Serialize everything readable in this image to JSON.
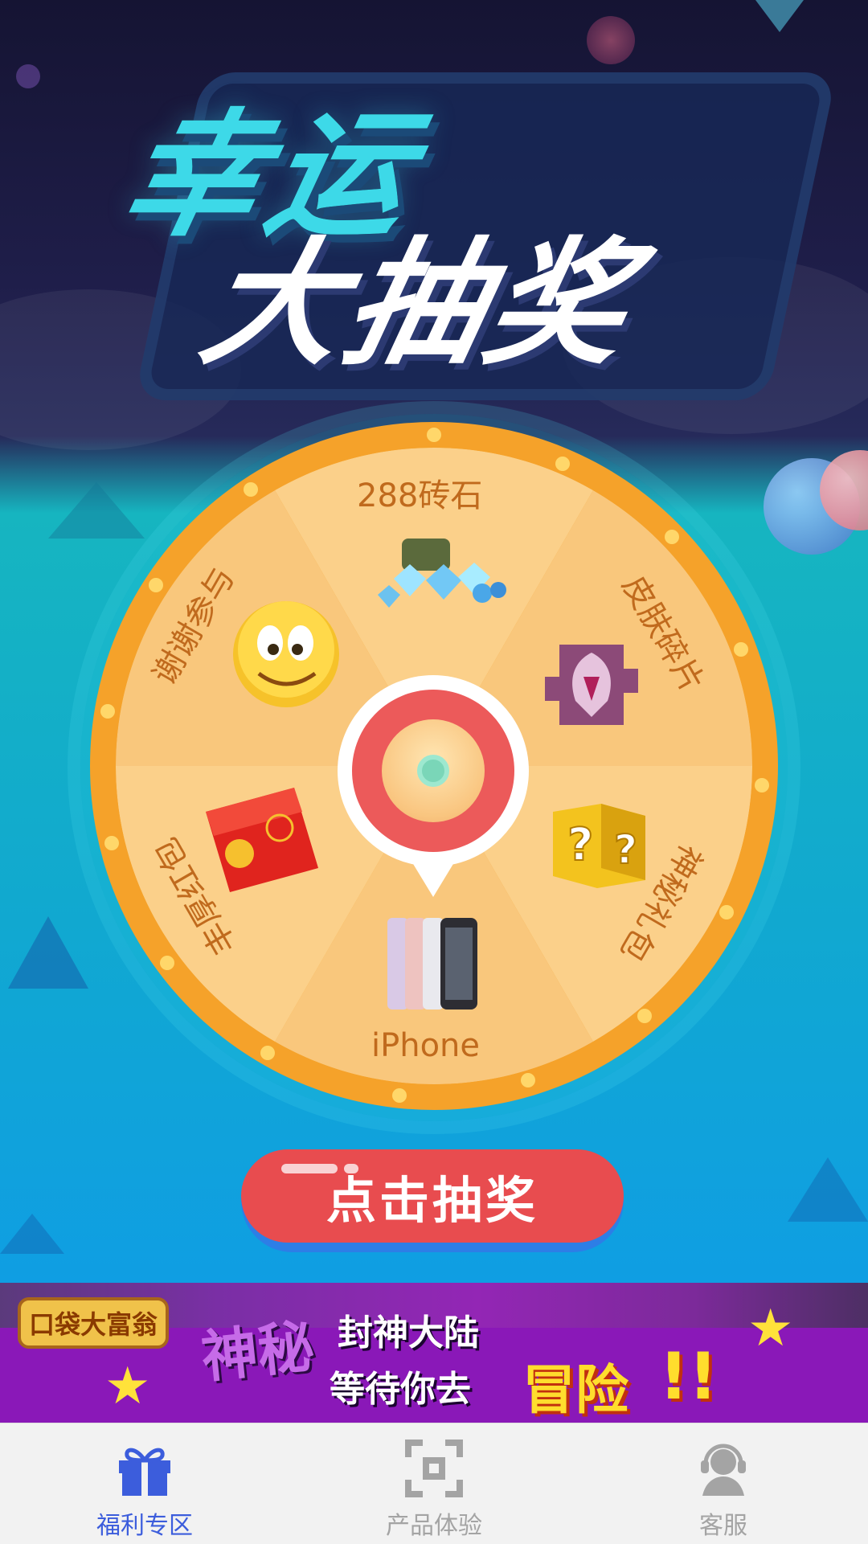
{
  "title": {
    "line1": "幸运",
    "line2": "大抽奖"
  },
  "wheel": {
    "prizes": [
      {
        "label": "288砖石",
        "icon": "diamonds-icon"
      },
      {
        "label": "皮肤碎片",
        "icon": "skin-fragment-icon"
      },
      {
        "label": "神秘礼包",
        "icon": "mystery-box-icon"
      },
      {
        "label": "iPhone",
        "icon": "iphone-icon"
      },
      {
        "label": "丰厚红包",
        "icon": "red-envelope-icon"
      },
      {
        "label": "谢谢参与",
        "icon": "smiley-icon"
      }
    ],
    "colors": {
      "ring": "#f5a22a",
      "segment": "#fbd08a",
      "center": "#ec5a5a"
    }
  },
  "draw_button": {
    "label": "点击抽奖"
  },
  "banner": {
    "logo": "口袋大富翁",
    "text1": "神秘",
    "text2": "封神大陆",
    "text3": "等待你去",
    "text4": "冒险",
    "text5": "!!"
  },
  "tabbar": {
    "items": [
      {
        "label": "福利专区",
        "icon": "gift-icon",
        "active": true
      },
      {
        "label": "产品体验",
        "icon": "scan-icon",
        "active": false
      },
      {
        "label": "客服",
        "icon": "customer-service-icon",
        "active": false
      }
    ],
    "accent": "#3c5ddc"
  }
}
